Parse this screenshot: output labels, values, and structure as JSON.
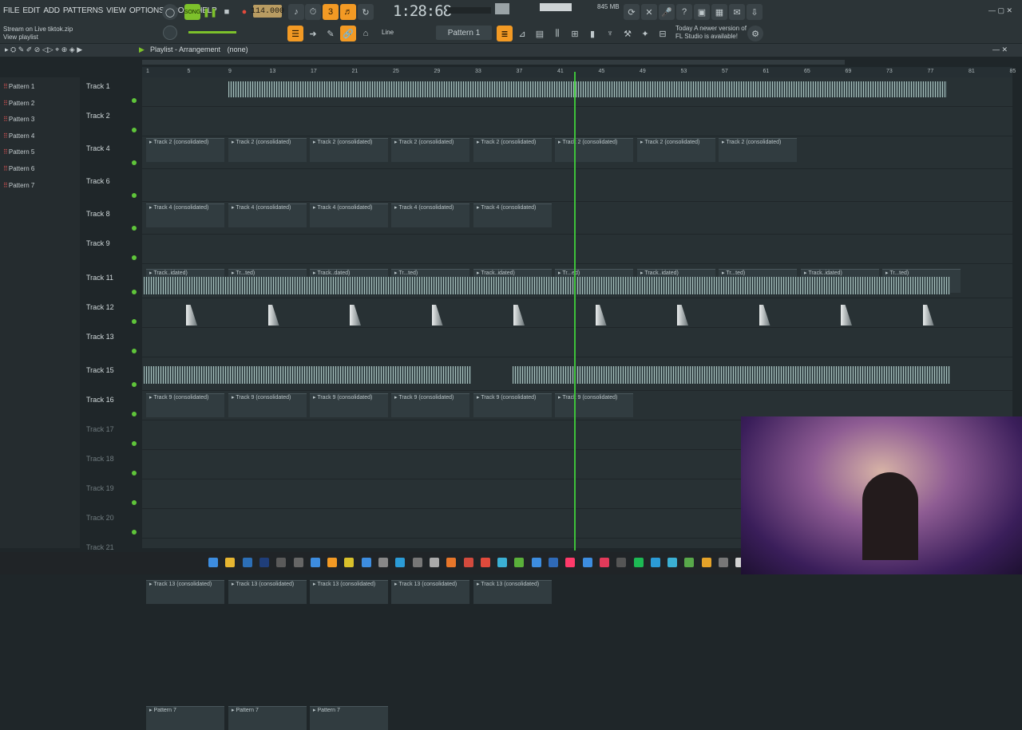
{
  "menu": [
    "FILE",
    "EDIT",
    "ADD",
    "PATTERNS",
    "VIEW",
    "OPTIONS",
    "TOOLS",
    "HELP"
  ],
  "toolbar": {
    "tempo": "114.000",
    "time": "1:28:68",
    "song_label": "SONG",
    "memory": "845 MB",
    "pattern": "Pattern 1",
    "snap": "Line"
  },
  "hint": {
    "line1": "Stream on Live tiktok.zip",
    "line2": "View playlist"
  },
  "news": {
    "line1": "Today  A newer version of",
    "line2": "FL Studio is available!"
  },
  "playlist": {
    "title": "Playlist - Arrangement",
    "sub": "(none)"
  },
  "patterns": [
    "Pattern 1",
    "Pattern 2",
    "Pattern 3",
    "Pattern 4",
    "Pattern 5",
    "Pattern 6",
    "Pattern 7"
  ],
  "ruler": [
    "1",
    "5",
    "9",
    "13",
    "17",
    "21",
    "25",
    "29",
    "33",
    "37",
    "41",
    "45",
    "49",
    "53",
    "57",
    "61",
    "65",
    "69",
    "73",
    "77",
    "81",
    "85"
  ],
  "tracks": [
    {
      "name": "Track 1",
      "clips": []
    },
    {
      "name": "Track 2",
      "clips": [
        "Track 2 (consolidated)",
        "Track 2 (consolidated)",
        "Track 2 (consolidated)",
        "Track 2 (consolidated)",
        "Track 2 (consolidated)",
        "Track 2 (consolidated)",
        "Track 2 (consolidated)",
        "Track 2 (consolidated)"
      ]
    },
    {
      "name": "Track 4",
      "clips": [
        "Track 4 (consolidated)",
        "Track 4 (consolidated)",
        "Track 4 (consolidated)",
        "Track 4 (consolidated)",
        "Track 4 (consolidated)"
      ]
    },
    {
      "name": "Track 6",
      "clips": [
        "Track..idated)",
        "Tr...ted)",
        "Track..dated)",
        "Tr...ted)",
        "Track..idated)",
        "Tr...ed)",
        "Track..idated)",
        "Tr...ted)",
        "Track..idated)",
        "Tr...ted)"
      ]
    },
    {
      "name": "Track 8",
      "clips": []
    },
    {
      "name": "Track 9",
      "clips": [
        "Track 9 (consolidated)",
        "Track 9 (consolidated)",
        "Track 9 (consolidated)",
        "Track 9 (consolidated)",
        "Track 9 (consolidated)",
        "Track 9 (consolidated)"
      ]
    },
    {
      "name": "Track 11",
      "clips": []
    },
    {
      "name": "Track 12",
      "clips": []
    },
    {
      "name": "Track 13",
      "clips": [
        "Track 13 (consolidated)",
        "Track 13 (consolidated)",
        "Track 13 (consolidated)",
        "Track 13 (consolidated)",
        "Track 13 (consolidated)"
      ]
    },
    {
      "name": "Track 15",
      "clips": []
    },
    {
      "name": "Track 16",
      "clips": [
        "Pattern 7",
        "Pattern 7",
        "Pattern 7"
      ]
    },
    {
      "name": "Track 17",
      "clips": []
    },
    {
      "name": "Track 18",
      "clips": []
    },
    {
      "name": "Track 19",
      "clips": []
    },
    {
      "name": "Track 20",
      "clips": []
    },
    {
      "name": "Track 21",
      "clips": []
    }
  ]
}
